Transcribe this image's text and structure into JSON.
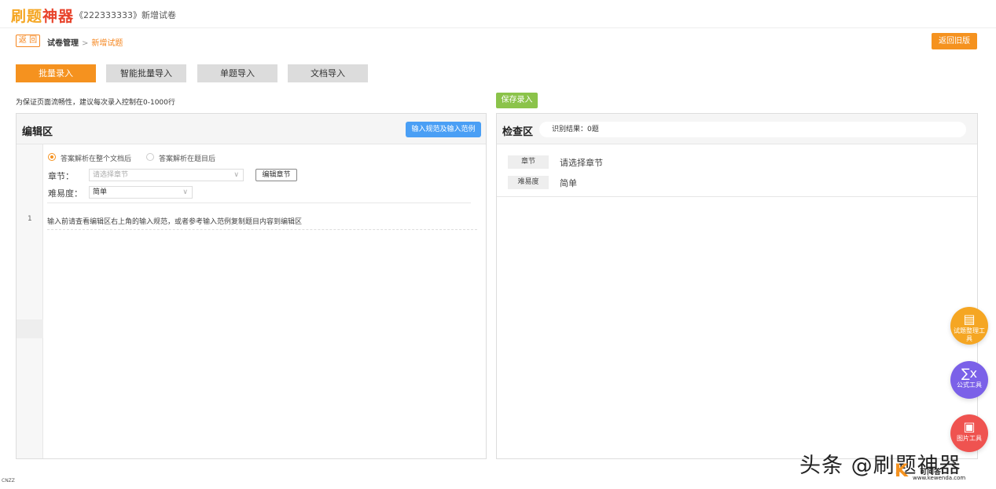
{
  "header": {
    "logo_part1": "刷题",
    "logo_part2": "神器",
    "paper_title": "《222333333》新增试卷"
  },
  "breadcrumb": {
    "back_label": "返 回",
    "parent": "试卷管理",
    "separator": ">",
    "current": "新增试题"
  },
  "toolbar": {
    "return_old_label": "返回旧版"
  },
  "tabs": [
    {
      "label": "批量录入",
      "active": true
    },
    {
      "label": "智能批量导入",
      "active": false
    },
    {
      "label": "单题导入",
      "active": false
    },
    {
      "label": "文档导入",
      "active": false
    }
  ],
  "hint": "为保证页面流畅性，建议每次录入控制在0-1000行",
  "save_entry_label": "保存录入",
  "editor": {
    "title": "编辑区",
    "spec_button": "输入规范及输入范例",
    "radio_options": [
      {
        "label": "答案解析在整个文档后",
        "checked": true
      },
      {
        "label": "答案解析在题目后",
        "checked": false
      }
    ],
    "chapter_label": "章节：",
    "chapter_placeholder": "请选择章节",
    "edit_chapter_button": "编辑章节",
    "difficulty_label": "难易度：",
    "difficulty_value": "简单",
    "line_number": "1",
    "line_text": "输入前请查看编辑区右上角的输入规范，或者参考输入范例复制题目内容到编辑区"
  },
  "checker": {
    "title": "检查区",
    "result_text": "识别结果：0题",
    "chapter_tag": "章节",
    "chapter_value": "请选择章节",
    "difficulty_tag": "难易度",
    "difficulty_value": "简单"
  },
  "floating_tools": [
    {
      "label": "试题整理工具",
      "icon": "box-icon",
      "color": "#f5a623"
    },
    {
      "label": "公式工具",
      "icon": "sigma-icon",
      "color": "#7b61e8"
    },
    {
      "label": "图片工具",
      "icon": "image-icon",
      "color": "#ef5350"
    }
  ],
  "watermark": {
    "main": "头条 @刷题神器",
    "site_name": "可问答",
    "site_url": "www.kewenda.com",
    "corner": "CNZZ"
  }
}
